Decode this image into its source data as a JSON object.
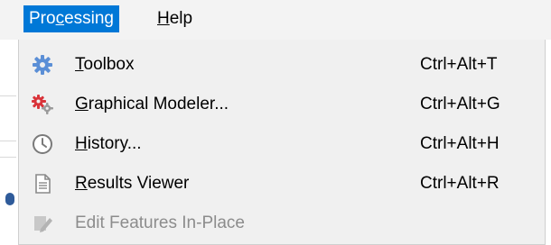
{
  "menubar": {
    "items": [
      {
        "label": "Processing",
        "access_key": "c",
        "active": true
      },
      {
        "label": "Help",
        "access_key": "H",
        "active": false
      }
    ]
  },
  "menu": {
    "items": [
      {
        "label": "Toolbox",
        "access_key": "T",
        "shortcut": "Ctrl+Alt+T",
        "icon": "gear-icon",
        "enabled": true
      },
      {
        "label": "Graphical Modeler...",
        "access_key": "G",
        "shortcut": "Ctrl+Alt+G",
        "icon": "model-gears-icon",
        "enabled": true
      },
      {
        "label": "History...",
        "access_key": "H",
        "shortcut": "Ctrl+Alt+H",
        "icon": "clock-icon",
        "enabled": true
      },
      {
        "label": "Results Viewer",
        "access_key": "R",
        "shortcut": "Ctrl+Alt+R",
        "icon": "document-icon",
        "enabled": true
      },
      {
        "label": "Edit Features In-Place",
        "access_key": "",
        "shortcut": "",
        "icon": "edit-features-icon",
        "enabled": false
      }
    ]
  },
  "colors": {
    "active_menu_bg": "#0078d7",
    "menu_bg": "#f0f0f0",
    "menubar_bg": "#f3f3f3",
    "disabled_text": "#8c8c8c"
  }
}
